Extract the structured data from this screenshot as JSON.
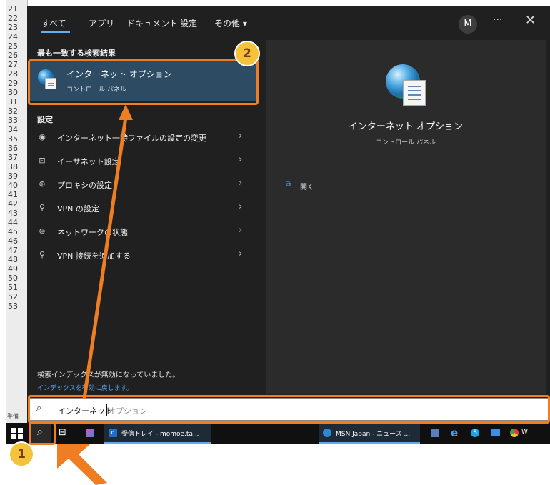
{
  "excel": {
    "row_numbers": [
      "21",
      "22",
      "23",
      "24",
      "25",
      "26",
      "27",
      "28",
      "29",
      "30",
      "31",
      "32",
      "33",
      "34",
      "35",
      "36",
      "37",
      "38",
      "39",
      "40",
      "41",
      "42",
      "43",
      "44",
      "45",
      "46",
      "47",
      "48",
      "49",
      "50",
      "51",
      "52",
      "53"
    ],
    "status_text": "準備"
  },
  "tabs": [
    {
      "label": "すべて",
      "active": true
    },
    {
      "label": "アプリ"
    },
    {
      "label": "ドキュメント"
    },
    {
      "label": "設定"
    },
    {
      "label": "その他 ▾"
    }
  ],
  "header": {
    "avatar_initial": "M",
    "more_label": "···",
    "close_label": "✕"
  },
  "best_match": {
    "section_title": "最も一致する検索結果",
    "title": "インターネット オプション",
    "subtitle": "コントロール パネル"
  },
  "settings": {
    "section_title": "設定",
    "items": [
      {
        "label": "インターネット一時ファイルの設定の変更",
        "icon": "globe-small-icon"
      },
      {
        "label": "イーサネット設定",
        "icon": "ethernet-icon"
      },
      {
        "label": "プロキシの設定",
        "icon": "globe-network-icon"
      },
      {
        "label": "VPN の設定",
        "icon": "vpn-icon"
      },
      {
        "label": "ネットワークの状態",
        "icon": "network-status-icon"
      },
      {
        "label": "VPN 接続を追加する",
        "icon": "vpn-icon"
      }
    ],
    "chevron": "›"
  },
  "index_notice": {
    "line1": "検索インデックスが無効になっていました。",
    "line2": "インデックスを有効に戻します。"
  },
  "preview": {
    "title": "インターネット オプション",
    "subtitle": "コントロール パネル",
    "open_label": "開く"
  },
  "search": {
    "typed": "インターネット",
    "suggestion": "オプション",
    "icon": "search-icon"
  },
  "taskbar": {
    "items": [
      {
        "label": "受信トレイ - momoe.ta...",
        "icon": "outlook-icon"
      },
      {
        "label": "MSN Japan - ニュース ...",
        "icon": "edge-icon"
      },
      {
        "label": "W",
        "icon": "chrome-icon"
      }
    ]
  },
  "callouts": [
    {
      "number": "1"
    },
    {
      "number": "2"
    }
  ],
  "colors": {
    "accent": "#ef7d22",
    "badge": "#f5c33b",
    "menu_bg": "#202020",
    "selection": "#2d4b63"
  }
}
